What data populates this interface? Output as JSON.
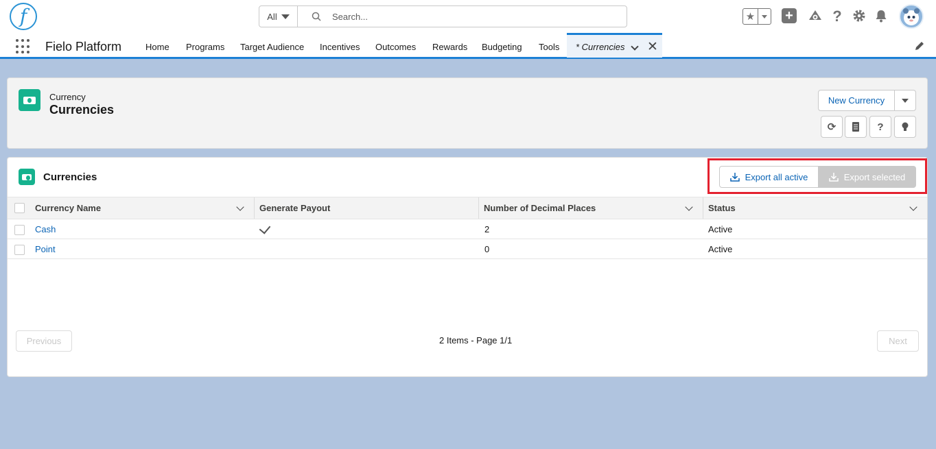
{
  "header": {
    "logo_letter": "f",
    "search_scope": "All",
    "search_placeholder": "Search..."
  },
  "nav": {
    "app_name": "Fielo Platform",
    "items": [
      "Home",
      "Programs",
      "Target Audience",
      "Incentives",
      "Outcomes",
      "Rewards",
      "Budgeting",
      "Tools"
    ],
    "active_tab": "* Currencies"
  },
  "page_header": {
    "entity_label": "Currency",
    "title": "Currencies",
    "new_button": "New Currency"
  },
  "list": {
    "title": "Currencies",
    "export_all": "Export all active",
    "export_selected": "Export selected",
    "columns": [
      "Currency Name",
      "Generate Payout",
      "Number of Decimal Places",
      "Status"
    ],
    "rows": [
      {
        "name": "Cash",
        "payout": true,
        "decimals": "2",
        "status": "Active"
      },
      {
        "name": "Point",
        "payout": false,
        "decimals": "0",
        "status": "Active"
      }
    ],
    "pagination": {
      "previous": "Previous",
      "info": "2 Items - Page 1/1",
      "next": "Next"
    }
  },
  "colors": {
    "brand_blue": "#1b80d5",
    "link_blue": "#0b64b5",
    "currency_icon_green": "#16b28e",
    "highlight_red": "#e4212f",
    "background": "#b0c4df"
  }
}
